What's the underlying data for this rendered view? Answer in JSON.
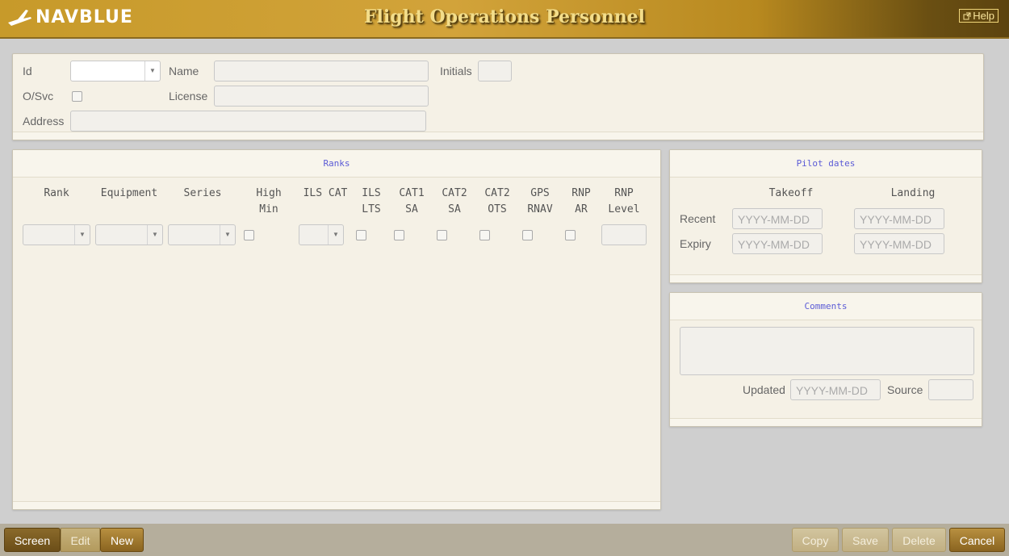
{
  "header": {
    "brand": "NAVBLUE",
    "title": "Flight Operations Personnel",
    "help": "Help"
  },
  "form": {
    "id_label": "Id",
    "name_label": "Name",
    "initials_label": "Initials",
    "osvc_label": "O/Svc",
    "license_label": "License",
    "address_label": "Address"
  },
  "ranks": {
    "title": "Ranks",
    "columns": [
      "Rank",
      "Equipment",
      "Series",
      "High\nMin",
      "ILS CAT",
      "ILS\nLTS",
      "CAT1\nSA",
      "CAT2\nSA",
      "CAT2\nOTS",
      "GPS\nRNAV",
      "RNP\nAR",
      "RNP\nLevel"
    ]
  },
  "pilot_dates": {
    "title": "Pilot dates",
    "takeoff": "Takeoff",
    "landing": "Landing",
    "recent": "Recent",
    "expiry": "Expiry",
    "date_placeholder": "YYYY-MM-DD"
  },
  "comments": {
    "title": "Comments",
    "updated": "Updated",
    "source": "Source",
    "date_placeholder": "YYYY-MM-DD"
  },
  "footer": {
    "left": [
      "Screen",
      "Edit",
      "New"
    ],
    "right": [
      "Copy",
      "Save",
      "Delete",
      "Cancel"
    ]
  },
  "colors": {
    "accent": "#c79a2a",
    "panel": "#f5f1e6",
    "heading": "#5b5bd6"
  }
}
